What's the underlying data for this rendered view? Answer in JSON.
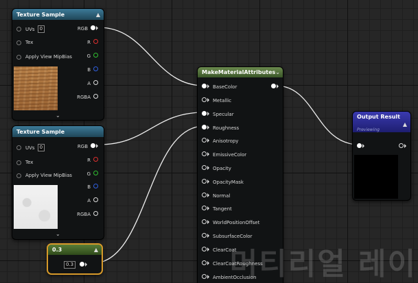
{
  "texture_node_1": {
    "title": "Texture Sample",
    "inputs": [
      {
        "label": "UVs",
        "value": "0"
      },
      {
        "label": "Tex",
        "value": ""
      },
      {
        "label": "Apply View MipBias",
        "value": ""
      }
    ],
    "outputs": [
      "RGB",
      "R",
      "G",
      "B",
      "A",
      "RGBA"
    ],
    "preview_texture": "wood-texture"
  },
  "texture_node_2": {
    "title": "Texture Sample",
    "inputs": [
      {
        "label": "UVs",
        "value": "0"
      },
      {
        "label": "Tex",
        "value": ""
      },
      {
        "label": "Apply View MipBias",
        "value": ""
      }
    ],
    "outputs": [
      "RGB",
      "R",
      "G",
      "B",
      "A",
      "RGBA"
    ],
    "preview_texture": "white-texture"
  },
  "constant_node": {
    "title": "0.3",
    "label": "",
    "value": "0.3"
  },
  "make_node": {
    "title": "MakeMaterialAttributes",
    "inputs": [
      "BaseColor",
      "Metallic",
      "Specular",
      "Roughness",
      "Anisotropy",
      "EmissiveColor",
      "Opacity",
      "OpacityMask",
      "Normal",
      "Tangent",
      "WorldPositionOffset",
      "SubsurfaceColor",
      "ClearCoat",
      "ClearCoatRoughness",
      "AmbientOcclusion"
    ]
  },
  "output_node": {
    "title": "Output Result",
    "subtitle": "Previewing"
  },
  "watermark": "머티리얼 레이",
  "colors": {
    "texture_header": "#2f6a86",
    "make_header": "#557a3c",
    "output_header": "#2a2aa0",
    "constant_border": "#d89a2a",
    "wire": "#f0f0f0"
  }
}
